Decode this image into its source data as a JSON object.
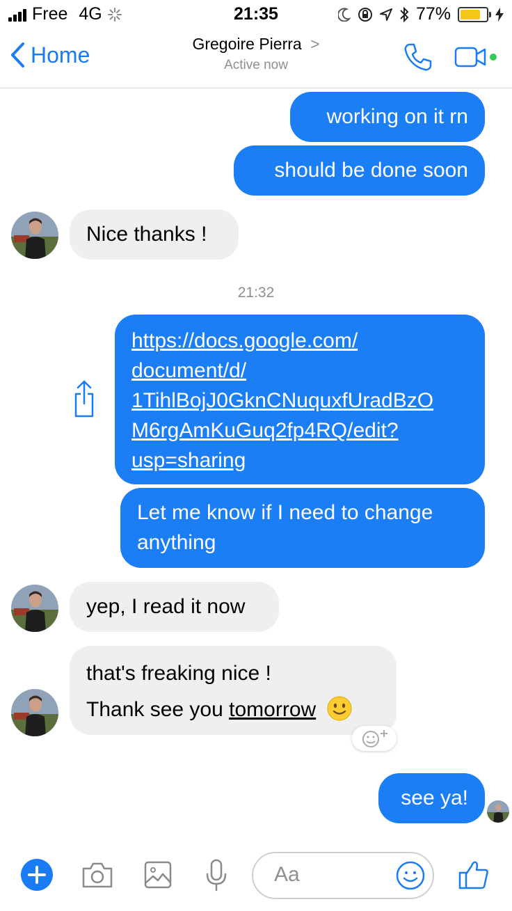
{
  "status_bar": {
    "carrier": "Free",
    "network": "4G",
    "time": "21:35",
    "battery": "77%",
    "battery_level": 0.77
  },
  "header": {
    "back_label": "Home",
    "contact_name": "Gregoire Pierra",
    "chevron": ">",
    "status": "Active now",
    "accent": "#1a7cf5"
  },
  "messages": {
    "m1": "working on it rn",
    "m2": "should be done soon",
    "m3": "Nice thanks !",
    "timestamp": "21:32",
    "link_lines": [
      "https://docs.google.com/",
      "document/d/",
      "1TihlBojJ0GknCNuquxfUradBzO",
      "M6rgAmKuGuq2fp4RQ/edit?",
      "usp=sharing"
    ],
    "m5": "Let me know if I need to change anything",
    "m6": "yep, I read it now",
    "m7_line1": "that's freaking nice !",
    "m7_line2_prefix": "Thank see you",
    "m7_line2_underlined": "tomorrow",
    "m8": "see ya!"
  },
  "composer": {
    "placeholder": "Aa"
  },
  "colors": {
    "outgoing_bubble": "#1c7ef5",
    "incoming_bubble": "#efefef",
    "active_dot": "#34c759"
  }
}
